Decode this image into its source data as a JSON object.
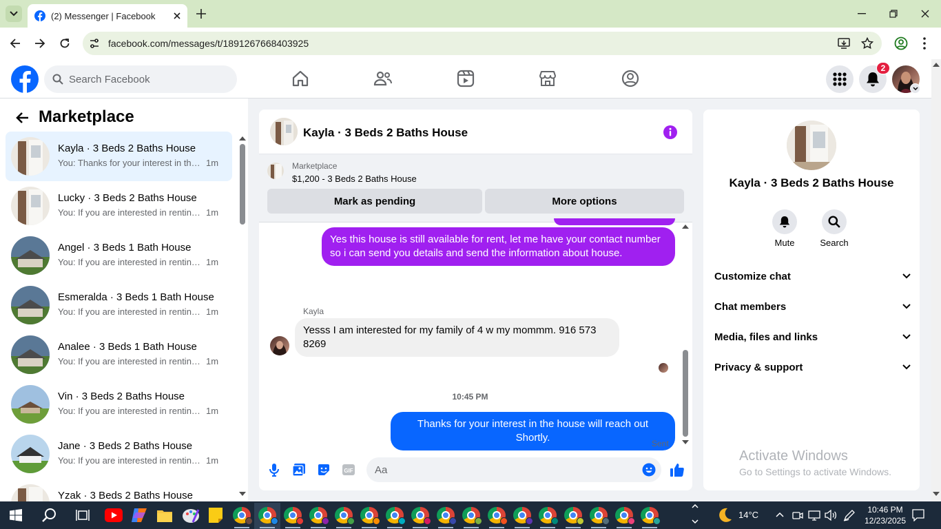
{
  "browser": {
    "tab_title": "(2) Messenger | Facebook",
    "url": "facebook.com/messages/t/1891267668403925"
  },
  "fb": {
    "search_placeholder": "Search Facebook",
    "notification_count": "2"
  },
  "sidebar": {
    "title": "Marketplace",
    "conversations": [
      {
        "name": "Kayla · 3 Beds 2 Baths House",
        "preview": "You: Thanks for your interest in the house will reach out Shortly.",
        "time": "1m",
        "active": true
      },
      {
        "name": "Lucky · 3 Beds 2 Baths House",
        "preview": "You: If you are interested in renting this house",
        "time": "1m"
      },
      {
        "name": "Angel · 3 Beds 1 Bath House",
        "preview": "You: If you are interested in renting this house",
        "time": "1m"
      },
      {
        "name": "Esmeralda · 3 Beds 1 Bath House",
        "preview": "You: If you are interested in renting this house",
        "time": "1m"
      },
      {
        "name": "Analee · 3 Beds 1 Bath House",
        "preview": "You: If you are interested in renting this house",
        "time": "1m"
      },
      {
        "name": "Vin · 3 Beds 2 Baths House",
        "preview": "You: If you are interested in renting this house",
        "time": "1m"
      },
      {
        "name": "Jane · 3 Beds 2 Baths House",
        "preview": "You: If you are interested in renting this house",
        "time": "1m"
      },
      {
        "name": "Yzak · 3 Beds 2 Baths House",
        "preview": "",
        "time": ""
      }
    ]
  },
  "chat": {
    "title": "Kayla · 3 Beds 2 Baths House",
    "listing_label": "Marketplace",
    "listing_detail": "$1,200 - 3 Beds 2 Baths House",
    "mark_pending": "Mark as pending",
    "more_options": "More options",
    "msg_out_1": "Yes this house is still available for rent, let me have your contact number so i can send you details and send the information about house.",
    "sender_name": "Kayla",
    "msg_in_1": "Yesss I am interested for my family of 4 w my mommm. 916 573 8269",
    "timestamp": "10:45 PM",
    "msg_out_2": "Thanks for your interest in the house will reach out Shortly.",
    "sent_status": "Sent",
    "composer_placeholder": "Aa"
  },
  "rpanel": {
    "name": "Kayla · 3 Beds 2 Baths House",
    "mute": "Mute",
    "search": "Search",
    "rows": [
      "Customize chat",
      "Chat members",
      "Media, files and links",
      "Privacy & support"
    ],
    "watermark_title": "Activate Windows",
    "watermark_sub": "Go to Settings to activate Windows."
  },
  "taskbar": {
    "weather": "14°C",
    "time": "10:46 PM",
    "date": "12/23/2025"
  },
  "colors": {
    "fb_blue": "#0866ff",
    "purple": "#a020f0",
    "active_row": "#e7f3ff"
  }
}
